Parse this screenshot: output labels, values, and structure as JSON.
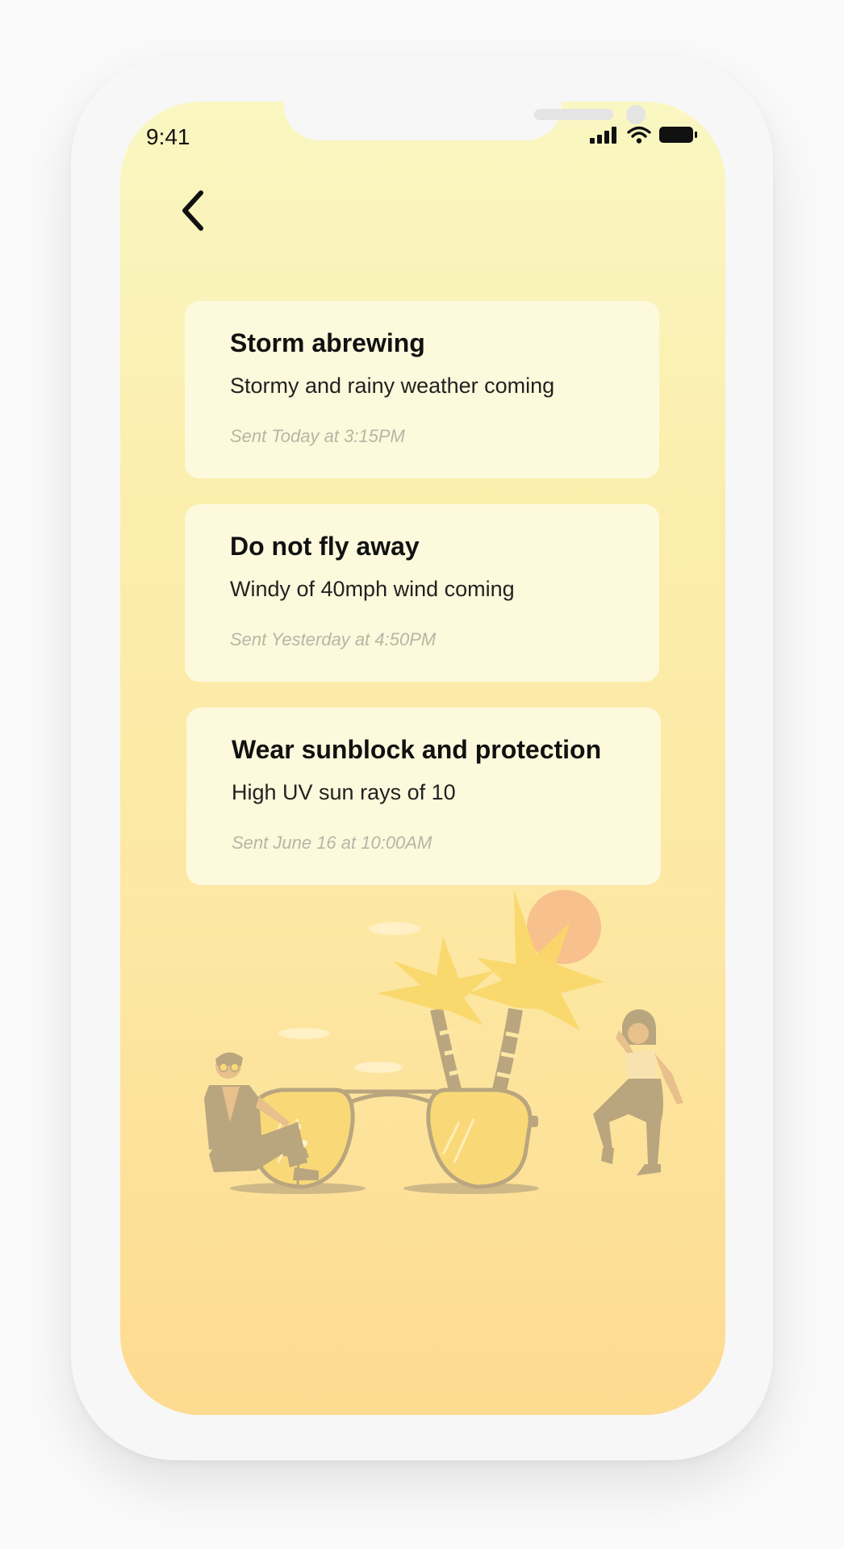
{
  "status_bar": {
    "time": "9:41",
    "signal_icon": "signal-bars-icon",
    "wifi_icon": "wifi-icon",
    "battery_icon": "battery-icon"
  },
  "header": {
    "back_icon": "chevron-left-icon"
  },
  "notifications": [
    {
      "title": "Storm abrewing",
      "body": "Stormy and rainy weather coming",
      "sent": "Sent Today at 3:15PM"
    },
    {
      "title": "Do not fly away",
      "body": "Windy of 40mph wind coming",
      "sent": "Sent Yesterday at 4:50PM"
    },
    {
      "title": "Wear sunblock and protection",
      "body": "High UV sun rays of 10",
      "sent": "Sent June 16 at 10:00AM"
    }
  ],
  "illustration": {
    "name": "beach-sunglasses-illustration",
    "colors": {
      "palm": "#f8d768",
      "sun": "#f6b98a",
      "figure": "#b9a67f",
      "lens": "#f9d977"
    }
  },
  "theme": {
    "gradient_top": "#faf7c2",
    "gradient_bottom": "#fddb90",
    "card_bg": "#fdf9dc"
  }
}
